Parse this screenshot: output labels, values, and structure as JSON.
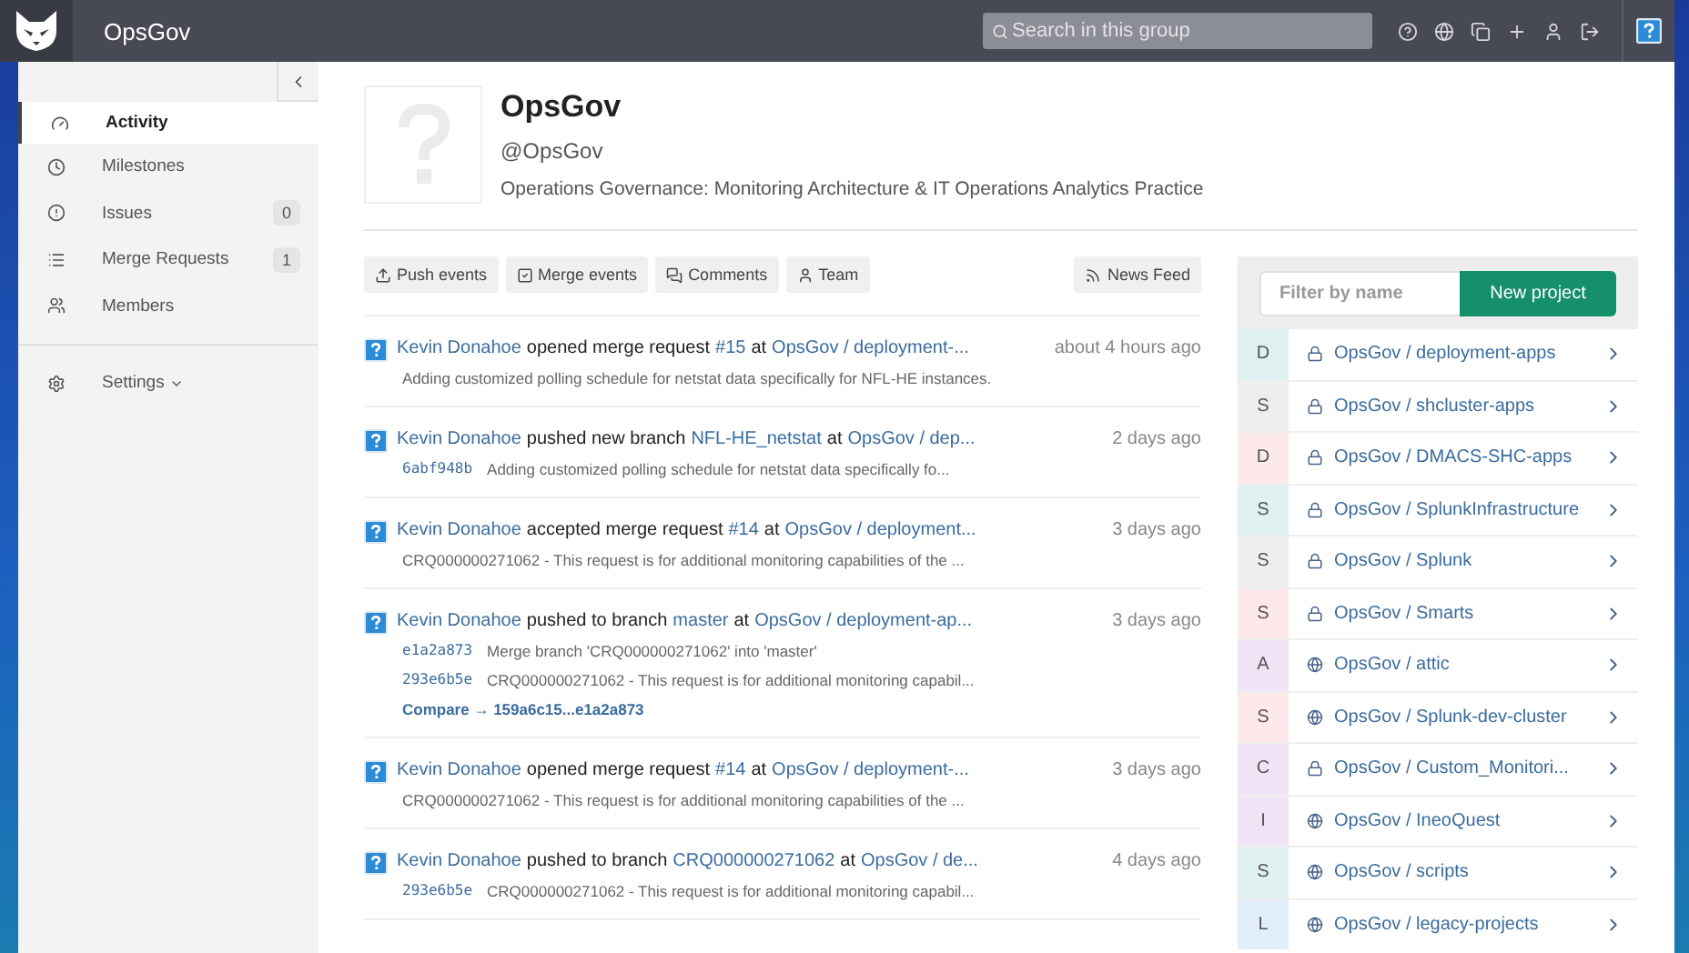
{
  "header": {
    "group": "OpsGov",
    "search": {
      "placeholder": "Search in this group"
    }
  },
  "sidebar": {
    "items": [
      {
        "label": "Activity",
        "selected": true
      },
      {
        "label": "Milestones",
        "selected": false
      },
      {
        "label": "Issues",
        "count": "0",
        "selected": false
      },
      {
        "label": "Merge Requests",
        "count": "1",
        "selected": false
      },
      {
        "label": "Members",
        "selected": false
      },
      {
        "label": "Settings",
        "dropdown": true,
        "selected": false,
        "divider_before": true
      }
    ]
  },
  "group": {
    "name": "OpsGov",
    "handle": "@OpsGov",
    "description": "Operations Governance: Monitoring Architecture & IT Operations Analytics Practice"
  },
  "filters": [
    {
      "label": "Push events"
    },
    {
      "label": "Merge events"
    },
    {
      "label": "Comments"
    },
    {
      "label": "Team"
    }
  ],
  "news_feed": "News Feed",
  "events": [
    {
      "parts": [
        {
          "kind": "link",
          "text": "Kevin Donahoe"
        },
        {
          "kind": "text",
          "text": "opened merge request"
        },
        {
          "kind": "link",
          "text": "#15"
        },
        {
          "kind": "text",
          "text": "at"
        },
        {
          "kind": "link",
          "text": "OpsGov / deployment-..."
        }
      ],
      "time": "about 4 hours ago",
      "details": [
        {
          "kind": "text",
          "text": "Adding customized polling schedule for netstat data specifically for NFL-HE instances."
        }
      ]
    },
    {
      "parts": [
        {
          "kind": "link",
          "text": "Kevin Donahoe"
        },
        {
          "kind": "text",
          "text": "pushed new branch"
        },
        {
          "kind": "link",
          "text": "NFL-HE_netstat"
        },
        {
          "kind": "text",
          "text": "at"
        },
        {
          "kind": "link",
          "text": "OpsGov / dep..."
        }
      ],
      "time": "2 days ago",
      "details": [
        {
          "kind": "commit",
          "sha": "6abf948b",
          "text": "Adding customized polling schedule for netstat data specifically fo..."
        }
      ]
    },
    {
      "parts": [
        {
          "kind": "link",
          "text": "Kevin Donahoe"
        },
        {
          "kind": "text",
          "text": "accepted merge request"
        },
        {
          "kind": "link",
          "text": "#14"
        },
        {
          "kind": "text",
          "text": "at"
        },
        {
          "kind": "link",
          "text": "OpsGov / deployment..."
        }
      ],
      "time": "3 days ago",
      "details": [
        {
          "kind": "text",
          "text": "CRQ000000271062 - This request is for additional monitoring capabilities of the ..."
        }
      ]
    },
    {
      "parts": [
        {
          "kind": "link",
          "text": "Kevin Donahoe"
        },
        {
          "kind": "text",
          "text": "pushed to branch"
        },
        {
          "kind": "link",
          "text": "master"
        },
        {
          "kind": "text",
          "text": "at"
        },
        {
          "kind": "link",
          "text": "OpsGov / deployment-ap..."
        }
      ],
      "time": "3 days ago",
      "details": [
        {
          "kind": "commit",
          "sha": "e1a2a873",
          "text": "Merge branch 'CRQ000000271062' into 'master'"
        },
        {
          "kind": "commit",
          "sha": "293e6b5e",
          "text": "CRQ000000271062 - This request is for additional monitoring capabil..."
        },
        {
          "kind": "compare",
          "text": "Compare → 159a6c15...e1a2a873"
        }
      ]
    },
    {
      "parts": [
        {
          "kind": "link",
          "text": "Kevin Donahoe"
        },
        {
          "kind": "text",
          "text": "opened merge request"
        },
        {
          "kind": "link",
          "text": "#14"
        },
        {
          "kind": "text",
          "text": "at"
        },
        {
          "kind": "link",
          "text": "OpsGov / deployment-..."
        }
      ],
      "time": "3 days ago",
      "details": [
        {
          "kind": "text",
          "text": "CRQ000000271062 - This request is for additional monitoring capabilities of the ..."
        }
      ]
    },
    {
      "parts": [
        {
          "kind": "link",
          "text": "Kevin Donahoe"
        },
        {
          "kind": "text",
          "text": "pushed to branch"
        },
        {
          "kind": "link",
          "text": "CRQ000000271062"
        },
        {
          "kind": "text",
          "text": "at"
        },
        {
          "kind": "link",
          "text": "OpsGov / de..."
        }
      ],
      "time": "4 days ago",
      "details": [
        {
          "kind": "commit",
          "sha": "293e6b5e",
          "text": "CRQ000000271062 - This request is for additional monitoring capabil..."
        }
      ]
    }
  ],
  "projects": {
    "filter": {
      "placeholder": "Filter by name"
    },
    "new_button": "New project",
    "items": [
      {
        "letter": "D",
        "color": "#dff0f0",
        "private": true,
        "name": "OpsGov / deployment-apps"
      },
      {
        "letter": "S",
        "color": "#eeeeee",
        "private": true,
        "name": "OpsGov / shcluster-apps"
      },
      {
        "letter": "D",
        "color": "#fde9ea",
        "private": true,
        "name": "OpsGov / DMACS-SHC-apps"
      },
      {
        "letter": "S",
        "color": "#dff0f0",
        "private": true,
        "name": "OpsGov / SplunkInfrastructure"
      },
      {
        "letter": "S",
        "color": "#eeeeee",
        "private": true,
        "name": "OpsGov / Splunk"
      },
      {
        "letter": "S",
        "color": "#fde9ea",
        "private": true,
        "name": "OpsGov / Smarts"
      },
      {
        "letter": "A",
        "color": "#efe3f5",
        "private": false,
        "name": "OpsGov / attic"
      },
      {
        "letter": "S",
        "color": "#fde9ea",
        "private": false,
        "name": "OpsGov / Splunk-dev-cluster"
      },
      {
        "letter": "C",
        "color": "#efe3f5",
        "private": true,
        "name": "OpsGov / Custom_Monitori..."
      },
      {
        "letter": "I",
        "color": "#efe3f5",
        "private": false,
        "name": "OpsGov / IneoQuest"
      },
      {
        "letter": "S",
        "color": "#dff0f0",
        "private": false,
        "name": "OpsGov / scripts"
      },
      {
        "letter": "L",
        "color": "#e1eefa",
        "private": false,
        "name": "OpsGov / legacy-projects"
      }
    ]
  }
}
